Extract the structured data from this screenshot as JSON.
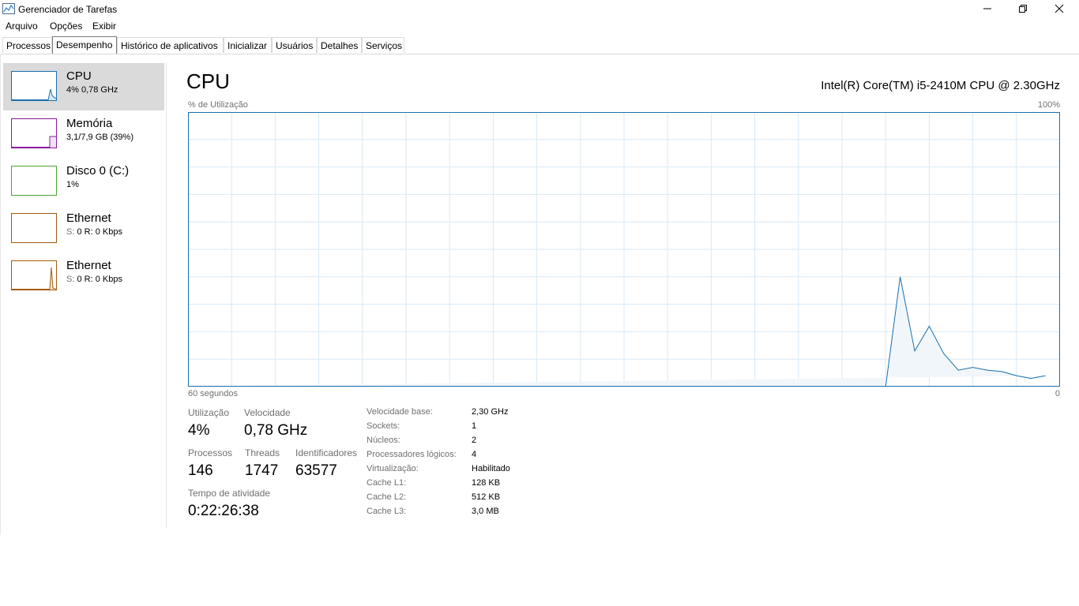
{
  "window": {
    "title": "Gerenciador de Tarefas"
  },
  "menu": [
    "Arquivo",
    "Opções",
    "Exibir"
  ],
  "tabs": [
    "Processos",
    "Desempenho",
    "Histórico de aplicativos",
    "Inicializar",
    "Usuários",
    "Detalhes",
    "Serviços"
  ],
  "active_tab": "Desempenho",
  "sidebar": [
    {
      "name": "CPU",
      "value": "4% 0,78 GHz",
      "color": "#1c6fad"
    },
    {
      "name": "Memória",
      "value": "3,1/7,9 GB (39%)",
      "color": "#8b1a9e"
    },
    {
      "name": "Disco 0 (C:)",
      "value": "1%",
      "color": "#4da233"
    },
    {
      "name": "Ethernet",
      "value_prefix": "S:",
      "value_mid": "0 R:",
      "value_suffix": "0 Kbps",
      "color": "#a75a0f"
    },
    {
      "name": "Ethernet",
      "value_prefix": "S:",
      "value_mid": "0 R:",
      "value_suffix": "0 Kbps",
      "color": "#a75a0f"
    }
  ],
  "main": {
    "title": "CPU",
    "cpu_model": "Intel(R) Core(TM) i5-2410M CPU @ 2.30GHz",
    "y_label": "% de Utilização",
    "y_max_label": "100%",
    "x_left_label": "60 segundos",
    "x_right_label": "0"
  },
  "chart_data": {
    "type": "area",
    "x": [
      60,
      59,
      58,
      57,
      56,
      55,
      54,
      53,
      52,
      51,
      50,
      49,
      48,
      47,
      46,
      45,
      44,
      43,
      42,
      41,
      40,
      39,
      38,
      37,
      36,
      35,
      34,
      33,
      32,
      31,
      30,
      29,
      28,
      27,
      26,
      25,
      24,
      23,
      22,
      21,
      20,
      19,
      18,
      17,
      16,
      15,
      14,
      13,
      12,
      11,
      10,
      9,
      8,
      7,
      6,
      5,
      4,
      3,
      2,
      1,
      0
    ],
    "values": [
      0,
      0,
      0,
      0,
      0,
      0,
      0,
      0,
      0,
      0,
      0,
      0,
      0,
      0,
      0,
      0,
      0,
      0,
      0,
      0,
      0,
      0,
      0,
      0,
      0,
      0,
      0,
      0,
      0,
      0,
      0,
      0,
      0,
      0,
      0,
      0,
      0,
      0,
      0,
      0,
      0,
      0,
      0,
      0,
      0,
      0,
      0,
      0,
      0,
      40,
      13,
      22,
      12,
      6,
      7,
      6,
      5.5,
      4,
      3,
      4
    ],
    "ylim": [
      0,
      100
    ],
    "xlabel": "60 segundos",
    "ylabel": "% de Utilização",
    "grid": true,
    "color": "#1c6fad"
  },
  "stats": {
    "utilizacao_label": "Utilização",
    "utilizacao": "4%",
    "velocidade_label": "Velocidade",
    "velocidade": "0,78 GHz",
    "processos_label": "Processos",
    "processos": "146",
    "threads_label": "Threads",
    "threads": "1747",
    "identificadores_label": "Identificadores",
    "identificadores": "63577",
    "tempo_label": "Tempo de atividade",
    "tempo": "0:22:26:38"
  },
  "specs": [
    {
      "label": "Velocidade base:",
      "value": "2,30 GHz"
    },
    {
      "label": "Sockets:",
      "value": "1"
    },
    {
      "label": "Núcleos:",
      "value": "2"
    },
    {
      "label": "Processadores lógicos:",
      "value": "4"
    },
    {
      "label": "Virtualização:",
      "value": "Habilitado"
    },
    {
      "label": "Cache L1:",
      "value": "128 KB"
    },
    {
      "label": "Cache L2:",
      "value": "512 KB"
    },
    {
      "label": "Cache L3:",
      "value": "3,0 MB"
    }
  ]
}
